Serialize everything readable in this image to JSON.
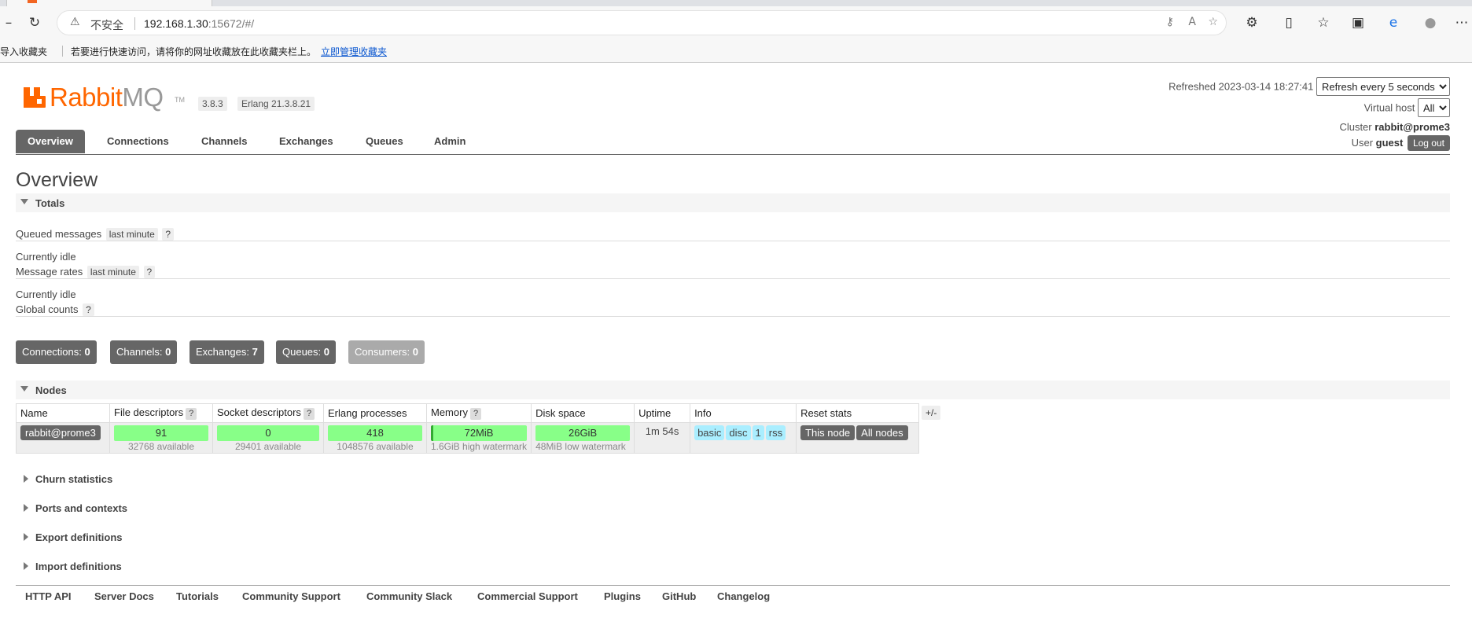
{
  "browser": {
    "security_label": "不安全",
    "url_host": "192.168.1.30",
    "url_rest": ":15672/#/",
    "favbar": {
      "import_label": "导入收藏夹",
      "hint": "若要进行快速访问，请将你的网址收藏放在此收藏夹栏上。",
      "manage_link": "立即管理收藏夹"
    },
    "icons": [
      "back-icon",
      "refresh-icon",
      "warning-icon",
      "key-icon",
      "read-aloud-icon",
      "add-favorite-icon",
      "extensions-icon",
      "split-screen-icon",
      "favorites-icon",
      "collections-icon",
      "edge-icon",
      "profile-icon",
      "more-icon"
    ]
  },
  "header": {
    "logo_part1": "Rabbit",
    "logo_part2": "MQ",
    "logo_tm": "TM",
    "version": "3.8.3",
    "erlang": "Erlang 21.3.8.21",
    "refreshed_label": "Refreshed 2023-03-14 18:27:41",
    "refresh_select": "Refresh every 5 seconds",
    "vhost_label": "Virtual host",
    "vhost_select": "All",
    "cluster_label": "Cluster",
    "cluster_name": "rabbit@prome3",
    "user_label": "User",
    "user_name": "guest",
    "logout_label": "Log out"
  },
  "tabs": [
    "Overview",
    "Connections",
    "Channels",
    "Exchanges",
    "Queues",
    "Admin"
  ],
  "page_title": "Overview",
  "totals": {
    "section_label": "Totals",
    "queued_label": "Queued messages",
    "queued_pill": "last minute",
    "help": "?",
    "idle1": "Currently idle",
    "rates_label": "Message rates",
    "rates_pill": "last minute",
    "idle2": "Currently idle",
    "global_label": "Global counts",
    "counts": [
      {
        "label": "Connections:",
        "value": "0"
      },
      {
        "label": "Channels:",
        "value": "0"
      },
      {
        "label": "Exchanges:",
        "value": "7"
      },
      {
        "label": "Queues:",
        "value": "0"
      },
      {
        "label": "Consumers:",
        "value": "0"
      }
    ]
  },
  "nodes": {
    "section_label": "Nodes",
    "columns": [
      "Name",
      "File descriptors",
      "Socket descriptors",
      "Erlang processes",
      "Memory",
      "Disk space",
      "Uptime",
      "Info",
      "Reset stats"
    ],
    "plus_minus": "+/-",
    "row": {
      "name": "rabbit@prome3",
      "fd_value": "91",
      "fd_sub": "32768 available",
      "sd_value": "0",
      "sd_sub": "29401 available",
      "ep_value": "418",
      "ep_sub": "1048576 available",
      "mem_value": "72MiB",
      "mem_sub": "1.6GiB high watermark",
      "disk_value": "26GiB",
      "disk_sub": "48MiB low watermark",
      "uptime": "1m 54s",
      "info_tags": [
        "basic",
        "disc",
        "1",
        "rss"
      ],
      "reset_this": "This node",
      "reset_all": "All nodes"
    },
    "mem_fill": 0.044,
    "bar_fill": 1.0
  },
  "collapsed_sections": [
    "Churn statistics",
    "Ports and contexts",
    "Export definitions",
    "Import definitions"
  ],
  "footer_links": [
    "HTTP API",
    "Server Docs",
    "Tutorials",
    "Community Support",
    "Community Slack",
    "Commercial Support",
    "Plugins",
    "GitHub",
    "Changelog"
  ],
  "colors": {
    "accent": "#ff6600",
    "bar_green": "#88ff88",
    "tag_blue": "#aaeeff",
    "dark": "#666666"
  }
}
